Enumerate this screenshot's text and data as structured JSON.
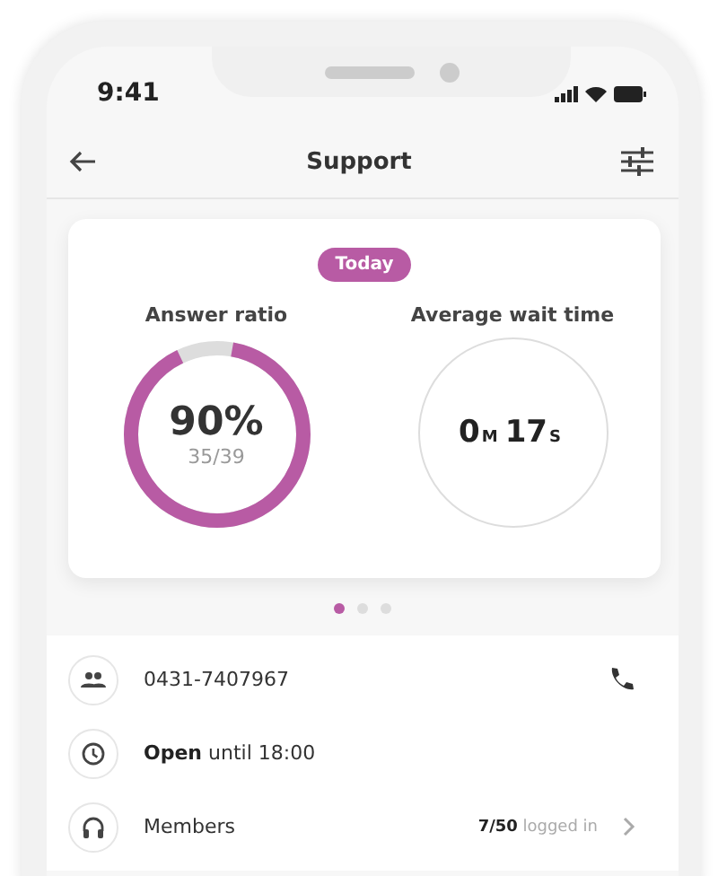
{
  "status_bar": {
    "time": "9:41"
  },
  "nav": {
    "title": "Support"
  },
  "summary": {
    "period": "Today",
    "answer_ratio": {
      "label": "Answer ratio",
      "value": "90%",
      "detail": "35/39",
      "level": 0.9
    },
    "wait_time": {
      "label": "Average wait time",
      "minutes": "0",
      "minutes_unit": "M",
      "seconds": "17",
      "seconds_unit": "S"
    }
  },
  "pager": [
    {
      "selected": true
    },
    {
      "selected": false
    },
    {
      "selected": false
    }
  ],
  "info_rows": [
    {
      "kind": "phone",
      "text": "0431-7407967"
    },
    {
      "kind": "hours",
      "text": "**Open** until 18:00"
    },
    {
      "kind": "members",
      "text": "Members",
      "detail": "**7/50** logged in"
    }
  ]
}
